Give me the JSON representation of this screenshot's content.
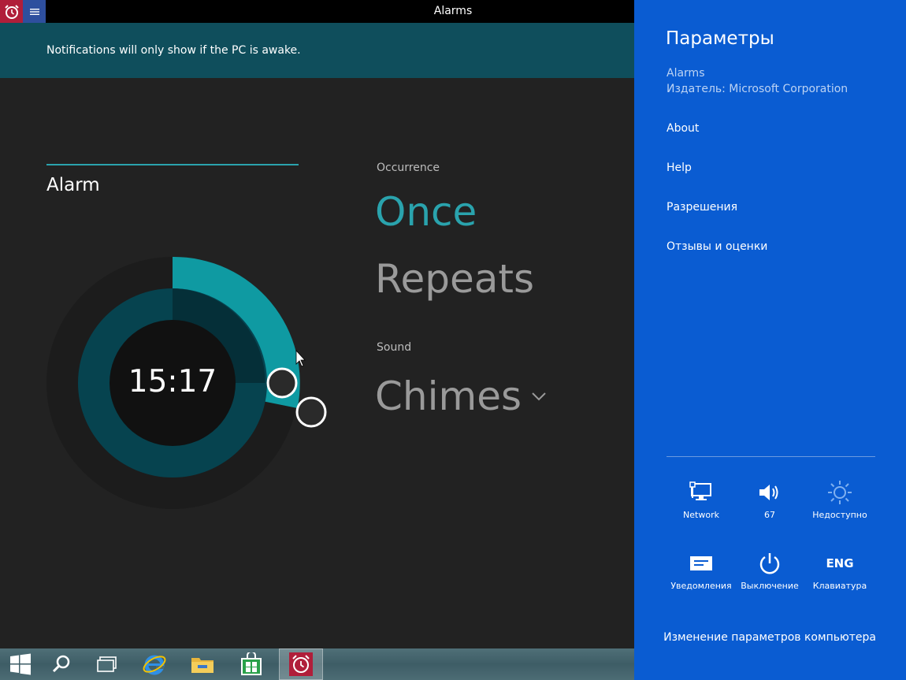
{
  "window": {
    "title": "Alarms"
  },
  "notification": {
    "text": "Notifications will only show if the PC is awake."
  },
  "alarm": {
    "name": "Alarm",
    "time": "15:17",
    "occurrence_label": "Occurrence",
    "occurrence_once": "Once",
    "occurrence_repeats": "Repeats",
    "sound_label": "Sound",
    "sound_value": "Chimes"
  },
  "settings_pane": {
    "title": "Параметры",
    "app_name": "Alarms",
    "publisher": "Издатель: Microsoft Corporation",
    "links": [
      "About",
      "Help",
      "Разрешения",
      "Отзывы и оценки"
    ],
    "quick_settings": [
      {
        "label": "Network",
        "icon": "network-icon"
      },
      {
        "label": "67",
        "icon": "volume-icon"
      },
      {
        "label": "Недоступно",
        "icon": "brightness-icon"
      },
      {
        "label": "Уведомления",
        "icon": "notifications-icon"
      },
      {
        "label": "Выключение",
        "icon": "power-icon"
      },
      {
        "label": "Клавиатура",
        "icon": "keyboard-icon",
        "text": "ENG"
      }
    ],
    "change_settings": "Изменение параметров компьютера"
  },
  "taskbar": {
    "items": [
      "start-icon",
      "search-icon",
      "task-view-icon",
      "internet-explorer-icon",
      "file-explorer-icon",
      "store-icon",
      "alarms-icon"
    ],
    "active": "alarms-icon"
  },
  "colors": {
    "accent": "#2aa3ad",
    "settings_pane": "#0a5cd2",
    "notice_bar": "#0f4e5c",
    "app_background": "#222222"
  }
}
